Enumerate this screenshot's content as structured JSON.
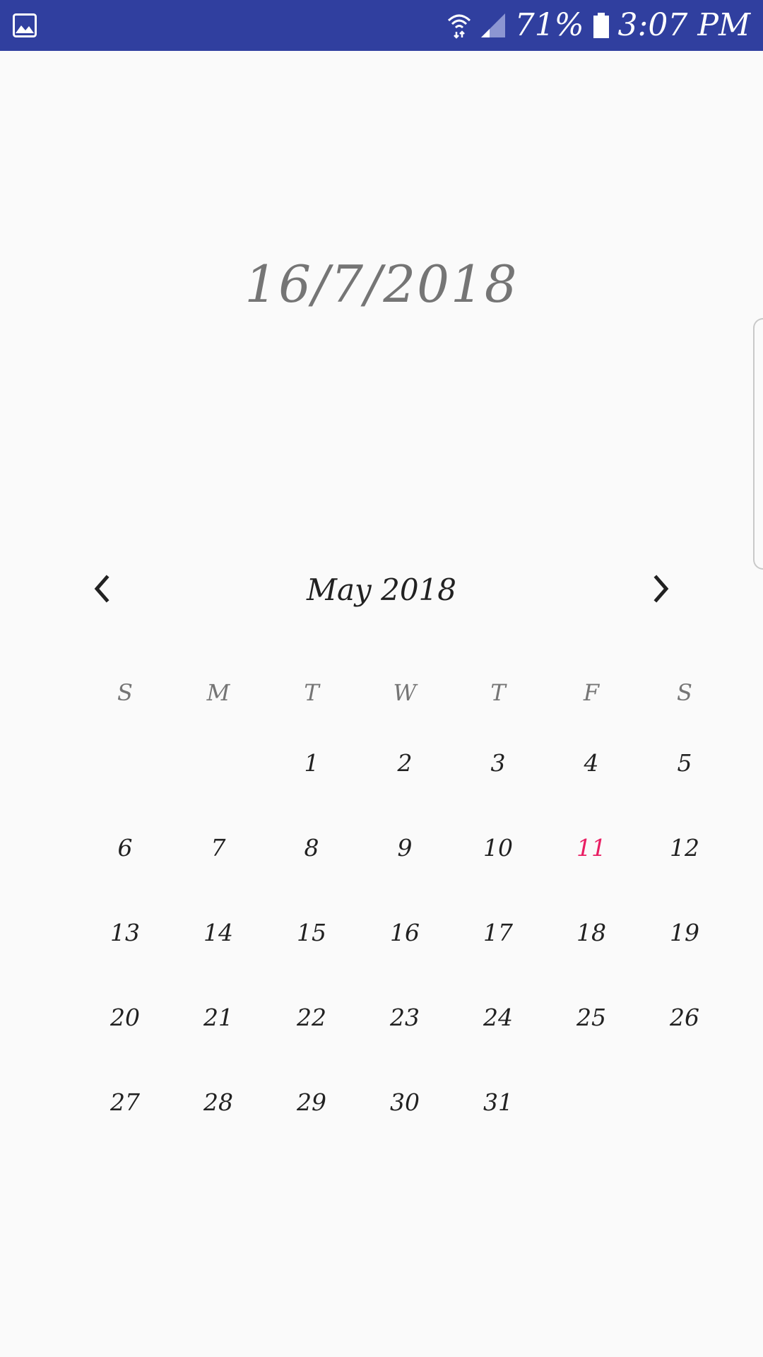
{
  "status_bar": {
    "left_icon": "gallery-icon",
    "wifi_icon": "wifi-icon",
    "signal_icon": "signal-icon",
    "battery_percent": "71%",
    "battery_icon": "battery-icon",
    "time": "3:07 PM",
    "background": "#303f9f"
  },
  "selected_date": "16/7/2018",
  "calendar": {
    "month_title": "May 2018",
    "prev_icon": "chevron-left-icon",
    "next_icon": "chevron-right-icon",
    "weekdays": [
      "S",
      "M",
      "T",
      "W",
      "T",
      "F",
      "S"
    ],
    "weeks": [
      [
        "",
        "",
        "1",
        "2",
        "3",
        "4",
        "5"
      ],
      [
        "6",
        "7",
        "8",
        "9",
        "10",
        "11",
        "12"
      ],
      [
        "13",
        "14",
        "15",
        "16",
        "17",
        "18",
        "19"
      ],
      [
        "20",
        "21",
        "22",
        "23",
        "24",
        "25",
        "26"
      ],
      [
        "27",
        "28",
        "29",
        "30",
        "31",
        "",
        ""
      ]
    ],
    "today": "11",
    "today_color": "#e91e63"
  }
}
